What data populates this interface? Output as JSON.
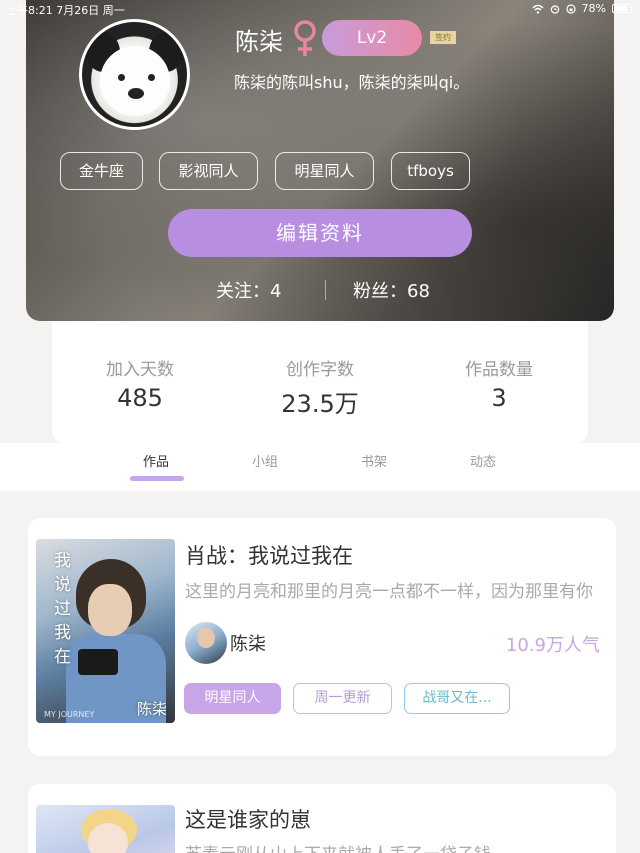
{
  "status_bar": {
    "left": "上午8:21  7月26日 周一",
    "battery": "78%"
  },
  "profile": {
    "username": "陈柒",
    "level": "Lv2",
    "sign_badge": "签约",
    "bio": "陈柒的陈叫shu，陈柒的柒叫qi。",
    "tags": [
      "金牛座",
      "影视同人",
      "明星同人",
      "tfboys"
    ],
    "edit_label": "编辑资料",
    "following_label": "关注：",
    "following_count": "4",
    "followers_label": "粉丝：",
    "followers_count": "68",
    "colors": {
      "level_gradient_start": "#c89bdb",
      "level_gradient_end": "#e98aa5",
      "edit_button": "#b88ee0",
      "female_icon": "#e7879e"
    }
  },
  "stats": [
    {
      "label": "加入天数",
      "value": "485"
    },
    {
      "label": "创作字数",
      "value": "23.5万"
    },
    {
      "label": "作品数量",
      "value": "3"
    }
  ],
  "tabs": [
    {
      "label": "作品",
      "active": true
    },
    {
      "label": "小组",
      "active": false
    },
    {
      "label": "书架",
      "active": false
    },
    {
      "label": "动态",
      "active": false
    }
  ],
  "works": [
    {
      "title": "肖战：我说过我在",
      "description": "这里的月亮和那里的月亮一点都不一样，因为那里有你",
      "cover_title": "我说过我在",
      "cover_author": "陈柒",
      "cover_subtitle": "MY JOURNEY",
      "author": "陈柒",
      "popularity": "10.9万人气",
      "chips": [
        "明星同人",
        "周一更新",
        "战哥又在..."
      ]
    },
    {
      "title": "这是谁家的崽",
      "description": "苏素云刚从山上下来就被人丢了一袋子钱"
    }
  ]
}
